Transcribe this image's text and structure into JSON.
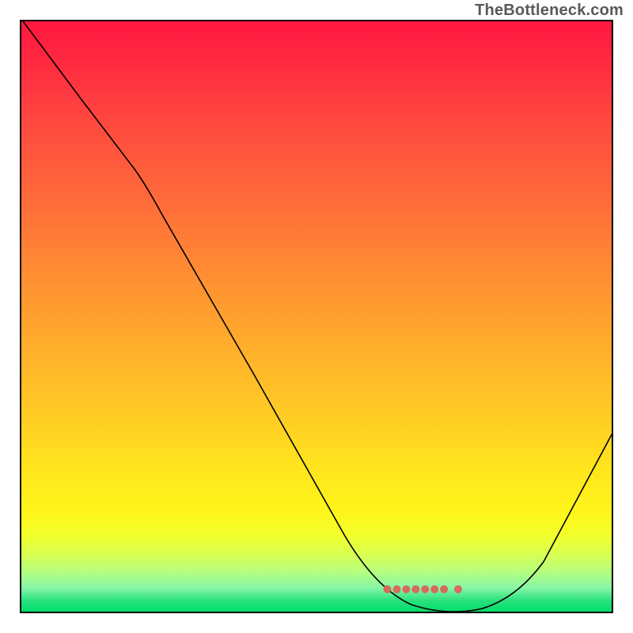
{
  "watermark": "TheBottleneck.com",
  "chart_data": {
    "type": "line",
    "title": "",
    "xlabel": "",
    "ylabel": "",
    "x": [
      0.0,
      0.04,
      0.1,
      0.16,
      0.22,
      0.28,
      0.34,
      0.4,
      0.46,
      0.52,
      0.58,
      0.64,
      0.7,
      0.74,
      0.78,
      0.82,
      0.86,
      0.9,
      0.94,
      1.0
    ],
    "values": [
      1.0,
      0.948,
      0.87,
      0.79,
      0.708,
      0.604,
      0.498,
      0.392,
      0.286,
      0.181,
      0.087,
      0.03,
      0.01,
      0.005,
      0.003,
      0.009,
      0.034,
      0.094,
      0.17,
      0.3
    ],
    "ylim": [
      0,
      1
    ],
    "xlim": [
      0,
      1
    ],
    "curve_segments": [
      {
        "type": "M",
        "xy": [
          0.003,
          1.0
        ]
      },
      {
        "type": "L",
        "xy": [
          0.1,
          0.87
        ]
      },
      {
        "type": "L",
        "xy": [
          0.19,
          0.752
        ]
      },
      {
        "type": "Q",
        "ctrl": [
          0.21,
          0.725
        ],
        "xy": [
          0.24,
          0.67
        ]
      },
      {
        "type": "L",
        "xy": [
          0.395,
          0.4
        ]
      },
      {
        "type": "L",
        "xy": [
          0.547,
          0.13
        ]
      },
      {
        "type": "Q",
        "ctrl": [
          0.6,
          0.04
        ],
        "xy": [
          0.66,
          0.012
        ]
      },
      {
        "type": "Q",
        "ctrl": [
          0.72,
          -0.008
        ],
        "xy": [
          0.78,
          0.005
        ]
      },
      {
        "type": "Q",
        "ctrl": [
          0.84,
          0.023
        ],
        "xy": [
          0.885,
          0.085
        ]
      },
      {
        "type": "L",
        "xy": [
          1.0,
          0.3
        ]
      }
    ],
    "dot_cluster": {
      "y_frac_from_bottom": 0.038,
      "x_fracs": [
        0.62,
        0.636,
        0.652,
        0.668,
        0.684,
        0.7,
        0.716,
        0.74
      ],
      "radius": 5
    },
    "background_gradient": {
      "stops": [
        {
          "pos": 0.0,
          "color": "#ff173f"
        },
        {
          "pos": 0.3,
          "color": "#ff6a3a"
        },
        {
          "pos": 0.66,
          "color": "#ffca25"
        },
        {
          "pos": 0.87,
          "color": "#f3ff2b"
        },
        {
          "pos": 1.0,
          "color": "#02de6c"
        }
      ]
    }
  }
}
